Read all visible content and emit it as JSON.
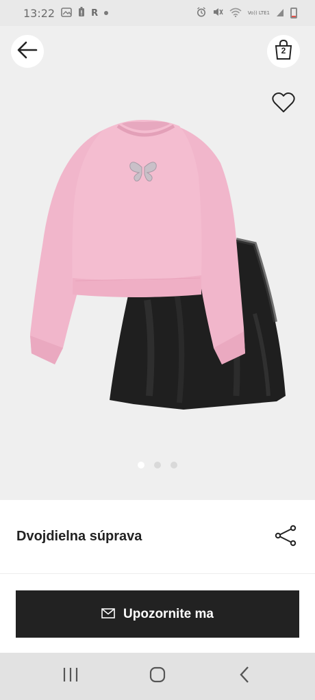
{
  "status_bar": {
    "time": "13:22",
    "carrier_letter": "R",
    "network_label": "Vo)) LTE1",
    "battery_level": 0.2,
    "battery_color": "#e5534b",
    "left_icons": [
      "gallery-icon",
      "battery-saver-icon",
      "r-icon",
      "notification-dot"
    ],
    "right_icons": [
      "alarm-icon",
      "mute-icon",
      "wifi-icon",
      "signal-icon",
      "battery-icon"
    ]
  },
  "header": {
    "back_icon": "arrow-left-icon",
    "bag_icon": "shopping-bag-icon",
    "bag_count": "2",
    "favorite_icon": "heart-icon"
  },
  "gallery": {
    "image_alt": "Pink cropped sweatshirt with butterfly print and black satin skirt",
    "total_images": 3,
    "active_index": 0,
    "colors": {
      "sweatshirt": "#f2b9cd",
      "skirt": "#1f1f1f",
      "background": "#efefef"
    }
  },
  "product": {
    "title": "Dvojdielna súprava",
    "share_icon": "share-icon"
  },
  "cta": {
    "label": "Upozornite ma",
    "icon": "mail-icon",
    "background_color": "#222222"
  },
  "nav_bar": {
    "items": [
      "recent-apps-icon",
      "home-icon",
      "back-icon"
    ]
  }
}
